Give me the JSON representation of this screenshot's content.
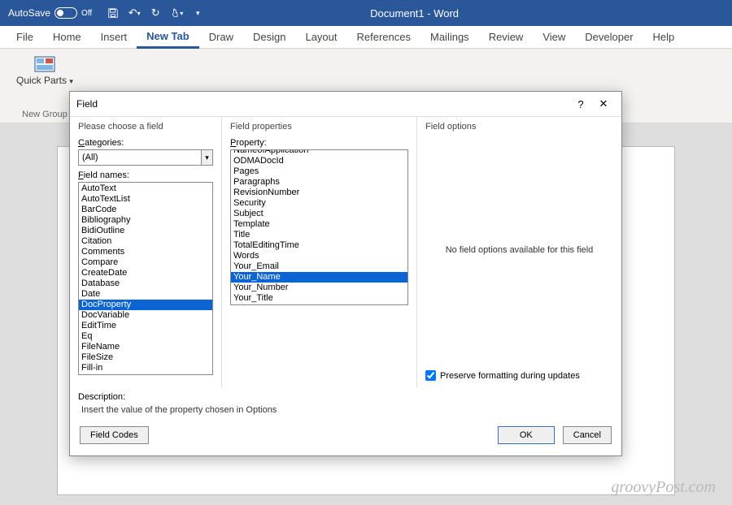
{
  "titlebar": {
    "autosave_label": "AutoSave",
    "autosave_state": "Off",
    "doc_title": "Document1 - Word"
  },
  "ribbon": {
    "tabs": [
      "File",
      "Home",
      "Insert",
      "New Tab",
      "Draw",
      "Design",
      "Layout",
      "References",
      "Mailings",
      "Review",
      "View",
      "Developer",
      "Help"
    ],
    "active_tab": "New Tab",
    "quick_parts": "Quick Parts",
    "group_label": "New Group"
  },
  "dialog": {
    "title": "Field",
    "left_heading": "Please choose a field",
    "categories_label": "Categories:",
    "categories_value": "(All)",
    "field_names_label": "Field names:",
    "field_names": [
      "AutoText",
      "AutoTextList",
      "BarCode",
      "Bibliography",
      "BidiOutline",
      "Citation",
      "Comments",
      "Compare",
      "CreateDate",
      "Database",
      "Date",
      "DocProperty",
      "DocVariable",
      "EditTime",
      "Eq",
      "FileName",
      "FileSize",
      "Fill-in"
    ],
    "selected_field": "DocProperty",
    "mid_heading": "Field properties",
    "property_label": "Property:",
    "properties": [
      "NameofApplication",
      "ODMADocId",
      "Pages",
      "Paragraphs",
      "RevisionNumber",
      "Security",
      "Subject",
      "Template",
      "Title",
      "TotalEditingTime",
      "Words",
      "Your_Email",
      "Your_Name",
      "Your_Number",
      "Your_Title"
    ],
    "selected_property": "Your_Name",
    "right_heading": "Field options",
    "no_options_text": "No field options available for this field",
    "preserve_label": "Preserve formatting during updates",
    "preserve_checked": true,
    "description_label": "Description:",
    "description_text": "Insert the value of the property chosen in Options",
    "field_codes_btn": "Field Codes",
    "ok_btn": "OK",
    "cancel_btn": "Cancel"
  },
  "watermark": "groovyPost.com"
}
